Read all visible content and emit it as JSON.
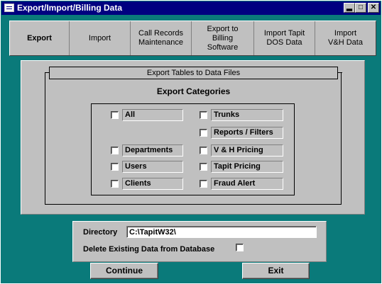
{
  "window": {
    "title": "Export/Import/Billing Data"
  },
  "tabs": [
    {
      "label": "Export"
    },
    {
      "label": "Import"
    },
    {
      "label": "Call Records\nMaintenance"
    },
    {
      "label": "Export to\nBilling\nSoftware"
    },
    {
      "label": "Import Tapit\nDOS Data"
    },
    {
      "label": "Import\nV&H Data"
    }
  ],
  "export_panel": {
    "frame_label": "Export Tables to Data Files",
    "categories_title": "Export Categories",
    "categories": {
      "all": "All",
      "departments": "Departments",
      "users": "Users",
      "clients": "Clients",
      "trunks": "Trunks",
      "reports": "Reports / Filters",
      "vh_pricing": "V & H Pricing",
      "tapit_pricing": "Tapit Pricing",
      "fraud_alert": "Fraud Alert"
    }
  },
  "directory": {
    "label": "Directory",
    "value": "C:\\TapitW32\\"
  },
  "delete_existing": {
    "label": "Delete Existing Data from Database",
    "checked": false
  },
  "buttons": {
    "continue_label": "Continue",
    "exit_label": "Exit"
  }
}
